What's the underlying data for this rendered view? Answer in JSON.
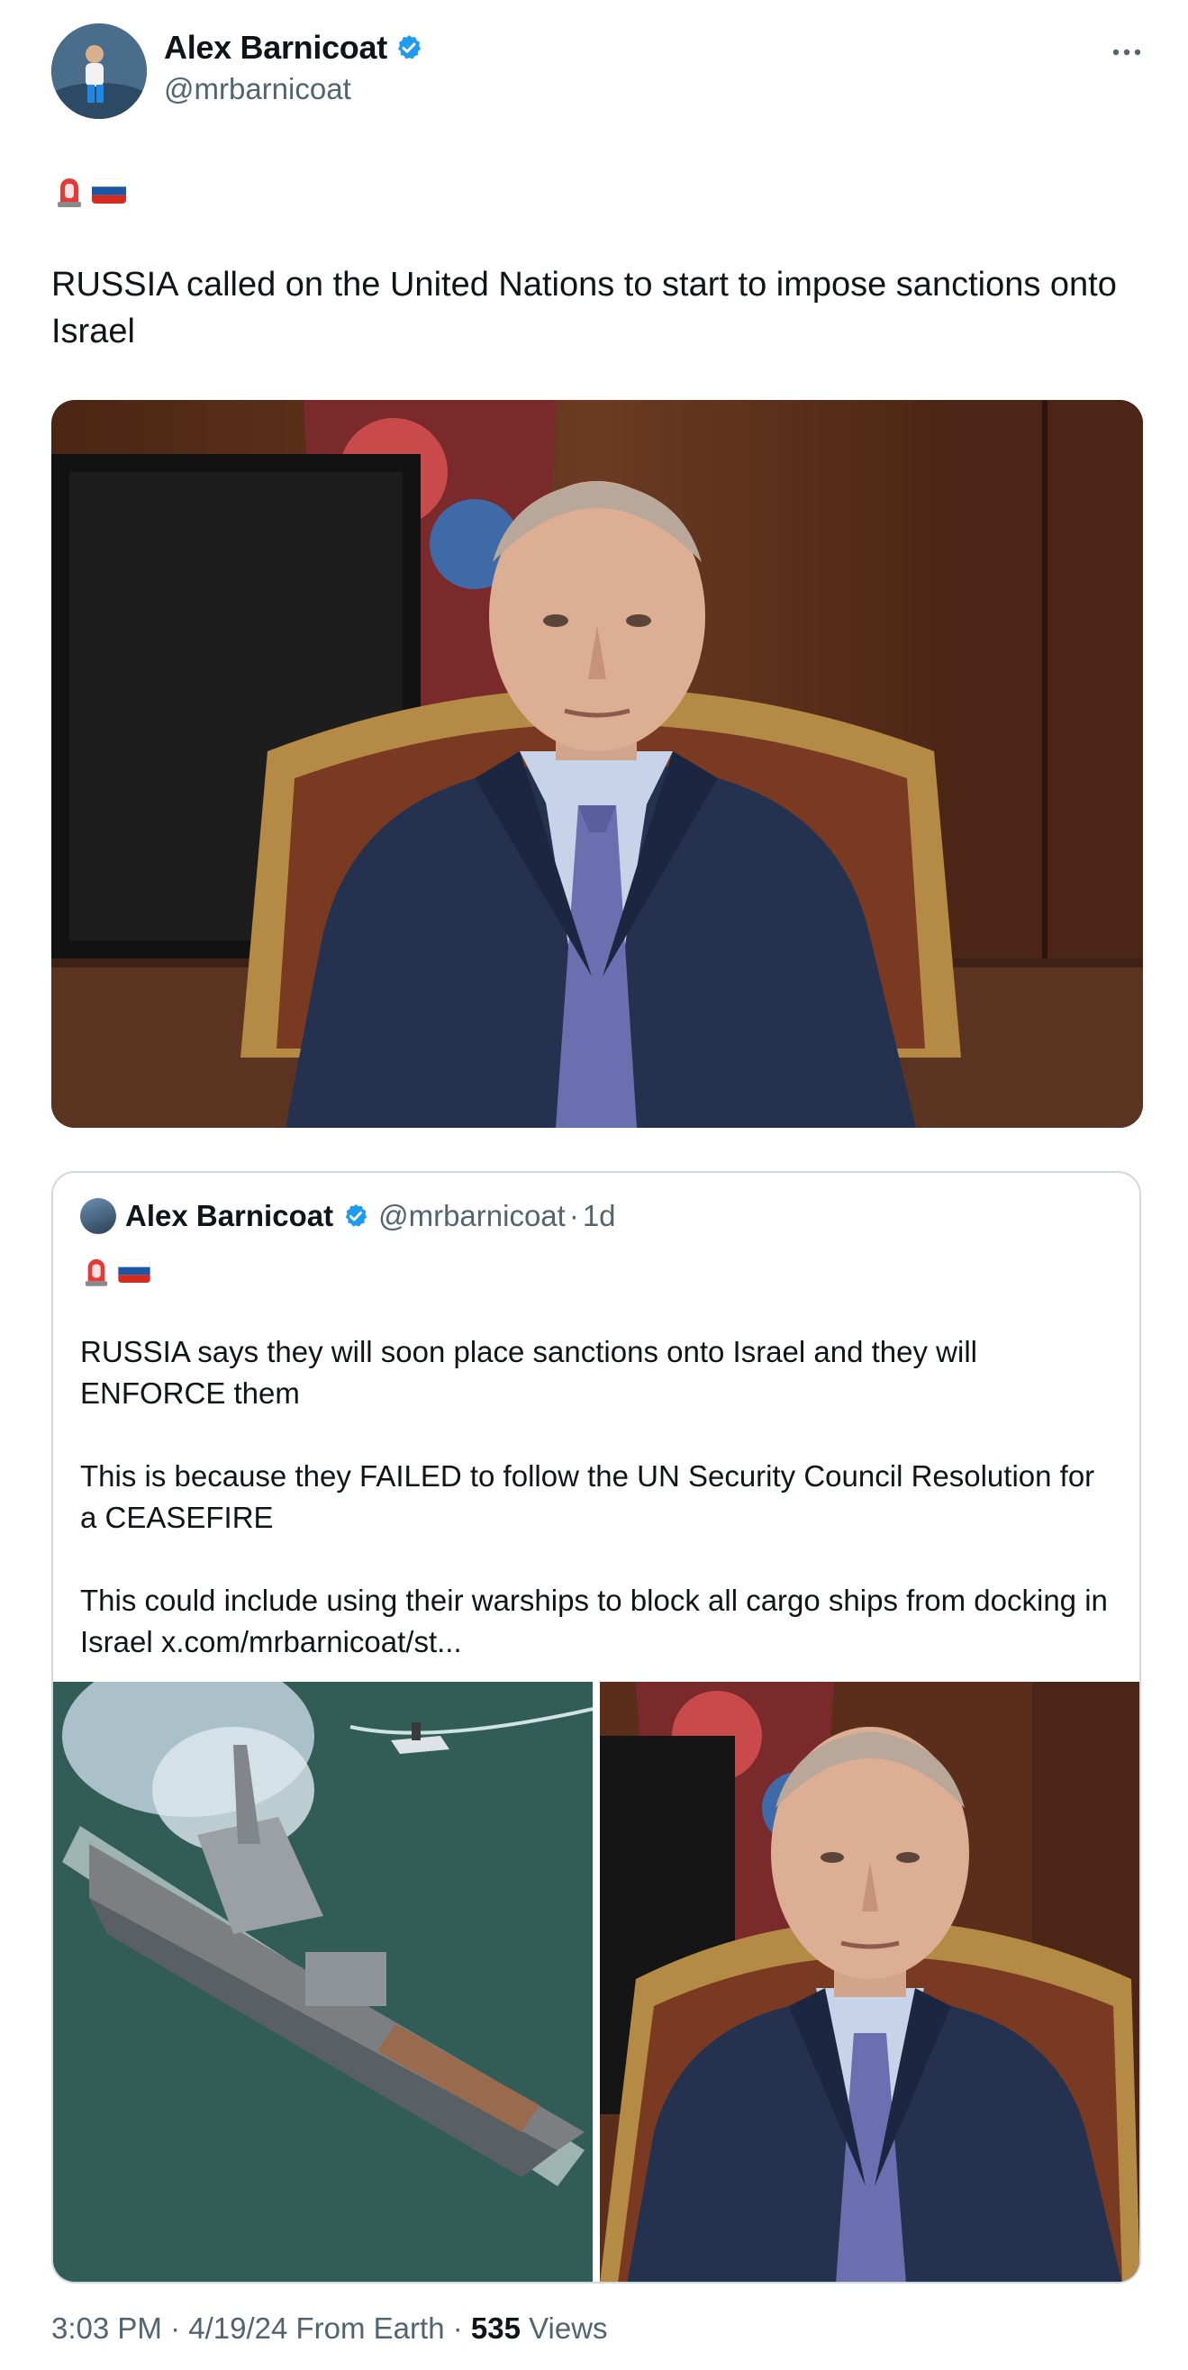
{
  "author": {
    "name": "Alex Barnicoat",
    "handle": "@mrbarnicoat",
    "verified": true
  },
  "tweet": {
    "emojis": [
      "siren",
      "russia-flag"
    ],
    "text": "RUSSIA called on the United Nations to start to impose sanctions onto Israel"
  },
  "quote": {
    "name": "Alex Barnicoat",
    "handle": "@mrbarnicoat",
    "sep": "·",
    "time": "1d",
    "emojis": [
      "siren",
      "russia-flag"
    ],
    "text": "RUSSIA says they will soon place sanctions onto Israel and they will ENFORCE them\n\nThis is because they FAILED to follow the UN Security Council Resolution for a CEASEFIRE\n\nThis could include using their warships to block all cargo ships from docking in Israel x.com/mrbarnicoat/st..."
  },
  "footer": {
    "time": "3:03 PM",
    "sep1": " · ",
    "date": "4/19/24",
    "source": " From Earth",
    "sep2": " · ",
    "views_count": "535",
    "views_label": " Views"
  },
  "colors": {
    "verified_blue": "#1d9bf0",
    "text": "#0f1419",
    "muted": "#536471",
    "border": "#cfd9de"
  }
}
